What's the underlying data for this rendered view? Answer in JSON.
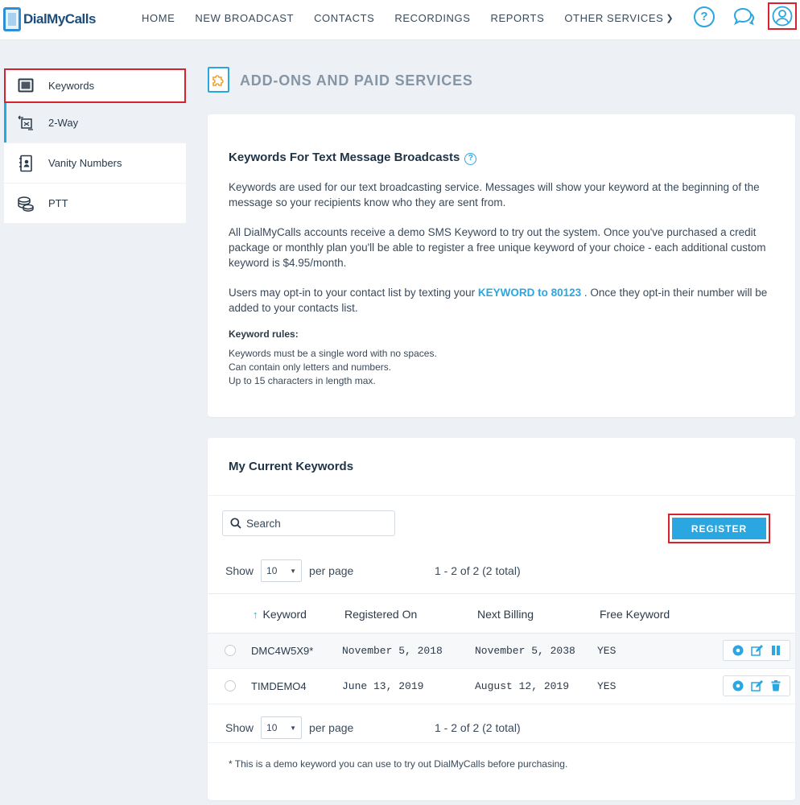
{
  "header": {
    "logo_text": "DialMyCalls",
    "nav": [
      "HOME",
      "NEW BROADCAST",
      "CONTACTS",
      "RECORDINGS",
      "REPORTS",
      "OTHER SERVICES"
    ],
    "help_glyph": "?"
  },
  "sidebar": {
    "items": [
      {
        "label": "Keywords",
        "icon": "tablet-icon"
      },
      {
        "label": "2-Way",
        "icon": "two-way-icon"
      },
      {
        "label": "Vanity Numbers",
        "icon": "contact-book-icon"
      },
      {
        "label": "PTT",
        "icon": "coins-icon"
      }
    ]
  },
  "page": {
    "title": "ADD-ONS AND PAID SERVICES"
  },
  "info": {
    "heading": "Keywords For Text Message Broadcasts",
    "p1": "Keywords are used for our text broadcasting service. Messages will show your keyword at the beginning of the message so your recipients know who they are sent from.",
    "p2": "All DialMyCalls accounts receive a demo SMS Keyword to try out the system. Once you've purchased a credit package or monthly plan you'll be able to register a free unique keyword of your choice - each additional custom keyword is $4.95/month.",
    "p3_before": "Users may opt-in to your contact list by texting your ",
    "p3_keyword": "KEYWORD to 80123",
    "p3_after": " . Once they opt-in their number will be added to your contacts list.",
    "rules_heading": "Keyword rules:",
    "rules": [
      "Keywords must be a single word with no spaces.",
      "Can contain only letters and numbers.",
      "Up to 15 characters in length max."
    ]
  },
  "keywords": {
    "heading": "My Current Keywords",
    "search_placeholder": "Search",
    "register_label": "REGISTER",
    "show_label": "Show",
    "per_page_value": "10",
    "per_page_label": "per page",
    "range_text": "1 - 2 of 2 (2 total)",
    "columns": [
      "Keyword",
      "Registered On",
      "Next Billing",
      "Free Keyword"
    ],
    "rows": [
      {
        "keyword": "DMC4W5X9*",
        "registered": "November 5, 2018",
        "next_billing": "November 5, 2038",
        "free": "YES"
      },
      {
        "keyword": "TIMDEMO4",
        "registered": "June 13, 2019",
        "next_billing": "August 12, 2019",
        "free": "YES"
      }
    ],
    "footnote": "* This is a demo keyword you can use to try out DialMyCalls before purchasing."
  },
  "colors": {
    "accent": "#2aa6e0",
    "highlight": "#d6232d",
    "background": "#edf1f5"
  }
}
